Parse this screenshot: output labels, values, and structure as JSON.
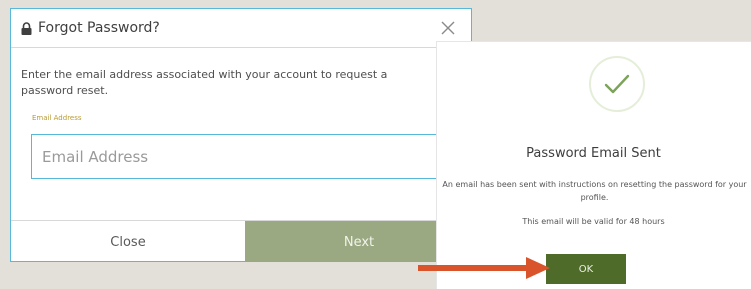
{
  "forgot_dialog": {
    "title": "Forgot Password?",
    "instructions": "Enter the email address associated with your account to request a password reset.",
    "field_label": "Email Address",
    "email_placeholder": "Email Address",
    "email_value": "",
    "close_label": "Close",
    "next_label": "Next",
    "icons": {
      "title_icon": "lock-icon",
      "dismiss_icon": "close-icon"
    }
  },
  "sent_dialog": {
    "title": "Password Email Sent",
    "message": "An email has been sent with instructions on resetting the password for your profile.",
    "validity": "This email will be valid for 48 hours",
    "ok_label": "OK",
    "icons": {
      "status_icon": "checkmark-icon"
    }
  },
  "annotation": {
    "icon": "arrow-right-icon",
    "color": "#d9532b"
  },
  "colors": {
    "accent_border": "#57b8d9",
    "next_button": "#9aa982",
    "ok_button": "#4e6b2a",
    "check": "#7ca35a",
    "field_label": "#b79c34"
  }
}
